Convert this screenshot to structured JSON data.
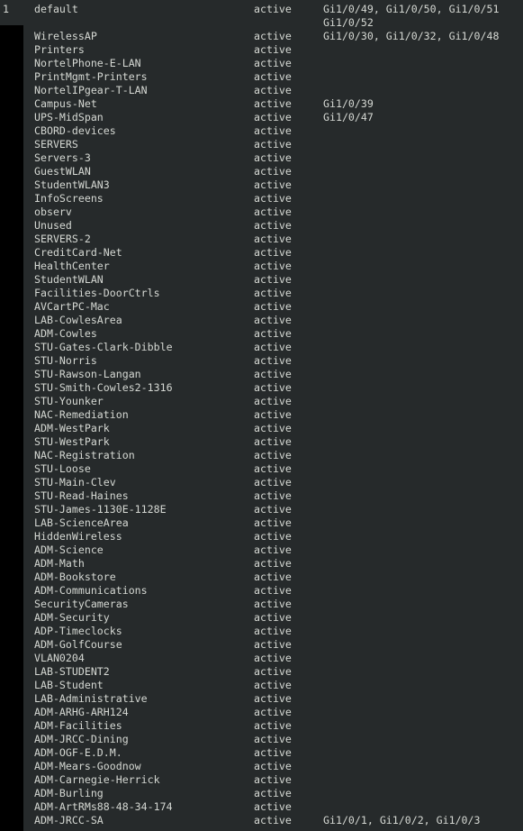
{
  "terminal": {
    "background_color": "#262a2b",
    "text_color": "#d5d8d3",
    "gutter_color": "#000000"
  },
  "table": {
    "rows": [
      {
        "vlan_id": "1",
        "name": "default",
        "status": "active",
        "ports": "Gi1/0/49, Gi1/0/50, Gi1/0/51"
      },
      {
        "vlan_id": "",
        "name": "",
        "status": "",
        "ports": "Gi1/0/52",
        "continuation": true
      },
      {
        "vlan_id": "",
        "name": "WirelessAP",
        "status": "active",
        "ports": "Gi1/0/30, Gi1/0/32, Gi1/0/48"
      },
      {
        "vlan_id": "",
        "name": "Printers",
        "status": "active",
        "ports": ""
      },
      {
        "vlan_id": "",
        "name": "NortelPhone-E-LAN",
        "status": "active",
        "ports": ""
      },
      {
        "vlan_id": "",
        "name": "PrintMgmt-Printers",
        "status": "active",
        "ports": ""
      },
      {
        "vlan_id": "",
        "name": "NortelIPgear-T-LAN",
        "status": "active",
        "ports": ""
      },
      {
        "vlan_id": "",
        "name": "Campus-Net",
        "status": "active",
        "ports": "Gi1/0/39"
      },
      {
        "vlan_id": "",
        "name": "UPS-MidSpan",
        "status": "active",
        "ports": "Gi1/0/47"
      },
      {
        "vlan_id": "",
        "name": "CBORD-devices",
        "status": "active",
        "ports": ""
      },
      {
        "vlan_id": "",
        "name": "SERVERS",
        "status": "active",
        "ports": ""
      },
      {
        "vlan_id": "",
        "name": "Servers-3",
        "status": "active",
        "ports": ""
      },
      {
        "vlan_id": "",
        "name": "GuestWLAN",
        "status": "active",
        "ports": ""
      },
      {
        "vlan_id": "",
        "name": "StudentWLAN3",
        "status": "active",
        "ports": ""
      },
      {
        "vlan_id": "",
        "name": "InfoScreens",
        "status": "active",
        "ports": ""
      },
      {
        "vlan_id": "",
        "name": "observ",
        "status": "active",
        "ports": ""
      },
      {
        "vlan_id": "",
        "name": "Unused",
        "status": "active",
        "ports": ""
      },
      {
        "vlan_id": "",
        "name": "SERVERS-2",
        "status": "active",
        "ports": ""
      },
      {
        "vlan_id": "",
        "name": "CreditCard-Net",
        "status": "active",
        "ports": ""
      },
      {
        "vlan_id": "",
        "name": "HealthCenter",
        "status": "active",
        "ports": ""
      },
      {
        "vlan_id": "",
        "name": "StudentWLAN",
        "status": "active",
        "ports": ""
      },
      {
        "vlan_id": "",
        "name": "Facilities-DoorCtrls",
        "status": "active",
        "ports": ""
      },
      {
        "vlan_id": "",
        "name": "AVCartPC-Mac",
        "status": "active",
        "ports": ""
      },
      {
        "vlan_id": "",
        "name": "LAB-CowlesArea",
        "status": "active",
        "ports": ""
      },
      {
        "vlan_id": "",
        "name": "ADM-Cowles",
        "status": "active",
        "ports": ""
      },
      {
        "vlan_id": "",
        "name": "STU-Gates-Clark-Dibble",
        "status": "active",
        "ports": ""
      },
      {
        "vlan_id": "",
        "name": "STU-Norris",
        "status": "active",
        "ports": ""
      },
      {
        "vlan_id": "",
        "name": "STU-Rawson-Langan",
        "status": "active",
        "ports": ""
      },
      {
        "vlan_id": "",
        "name": "STU-Smith-Cowles2-1316",
        "status": "active",
        "ports": ""
      },
      {
        "vlan_id": "",
        "name": "STU-Younker",
        "status": "active",
        "ports": ""
      },
      {
        "vlan_id": "",
        "name": "NAC-Remediation",
        "status": "active",
        "ports": ""
      },
      {
        "vlan_id": "",
        "name": "ADM-WestPark",
        "status": "active",
        "ports": ""
      },
      {
        "vlan_id": "",
        "name": "STU-WestPark",
        "status": "active",
        "ports": ""
      },
      {
        "vlan_id": "",
        "name": "NAC-Registration",
        "status": "active",
        "ports": ""
      },
      {
        "vlan_id": "",
        "name": "STU-Loose",
        "status": "active",
        "ports": ""
      },
      {
        "vlan_id": "",
        "name": "STU-Main-Clev",
        "status": "active",
        "ports": ""
      },
      {
        "vlan_id": "",
        "name": "STU-Read-Haines",
        "status": "active",
        "ports": ""
      },
      {
        "vlan_id": "",
        "name": "STU-James-1130E-1128E",
        "status": "active",
        "ports": ""
      },
      {
        "vlan_id": "",
        "name": "LAB-ScienceArea",
        "status": "active",
        "ports": ""
      },
      {
        "vlan_id": "",
        "name": "HiddenWireless",
        "status": "active",
        "ports": ""
      },
      {
        "vlan_id": "",
        "name": "ADM-Science",
        "status": "active",
        "ports": ""
      },
      {
        "vlan_id": "",
        "name": "ADM-Math",
        "status": "active",
        "ports": ""
      },
      {
        "vlan_id": "",
        "name": "ADM-Bookstore",
        "status": "active",
        "ports": ""
      },
      {
        "vlan_id": "",
        "name": "ADM-Communications",
        "status": "active",
        "ports": ""
      },
      {
        "vlan_id": "",
        "name": "SecurityCameras",
        "status": "active",
        "ports": ""
      },
      {
        "vlan_id": "",
        "name": "ADM-Security",
        "status": "active",
        "ports": ""
      },
      {
        "vlan_id": "",
        "name": "ADP-Timeclocks",
        "status": "active",
        "ports": ""
      },
      {
        "vlan_id": "",
        "name": "ADM-GolfCourse",
        "status": "active",
        "ports": ""
      },
      {
        "vlan_id": "",
        "name": "VLAN0204",
        "status": "active",
        "ports": ""
      },
      {
        "vlan_id": "",
        "name": "LAB-STUDENT2",
        "status": "active",
        "ports": ""
      },
      {
        "vlan_id": "",
        "name": "LAB-Student",
        "status": "active",
        "ports": ""
      },
      {
        "vlan_id": "",
        "name": "LAB-Administrative",
        "status": "active",
        "ports": ""
      },
      {
        "vlan_id": "",
        "name": "ADM-ARHG-ARH124",
        "status": "active",
        "ports": ""
      },
      {
        "vlan_id": "",
        "name": "ADM-Facilities",
        "status": "active",
        "ports": ""
      },
      {
        "vlan_id": "",
        "name": "ADM-JRCC-Dining",
        "status": "active",
        "ports": ""
      },
      {
        "vlan_id": "",
        "name": "ADM-OGF-E.D.M.",
        "status": "active",
        "ports": ""
      },
      {
        "vlan_id": "",
        "name": "ADM-Mears-Goodnow",
        "status": "active",
        "ports": ""
      },
      {
        "vlan_id": "",
        "name": "ADM-Carnegie-Herrick",
        "status": "active",
        "ports": ""
      },
      {
        "vlan_id": "",
        "name": "ADM-Burling",
        "status": "active",
        "ports": ""
      },
      {
        "vlan_id": "",
        "name": "ADM-ArtRMs88-48-34-174",
        "status": "active",
        "ports": ""
      },
      {
        "vlan_id": "",
        "name": "ADM-JRCC-SA",
        "status": "active",
        "ports": "Gi1/0/1, Gi1/0/2, Gi1/0/3"
      }
    ]
  }
}
